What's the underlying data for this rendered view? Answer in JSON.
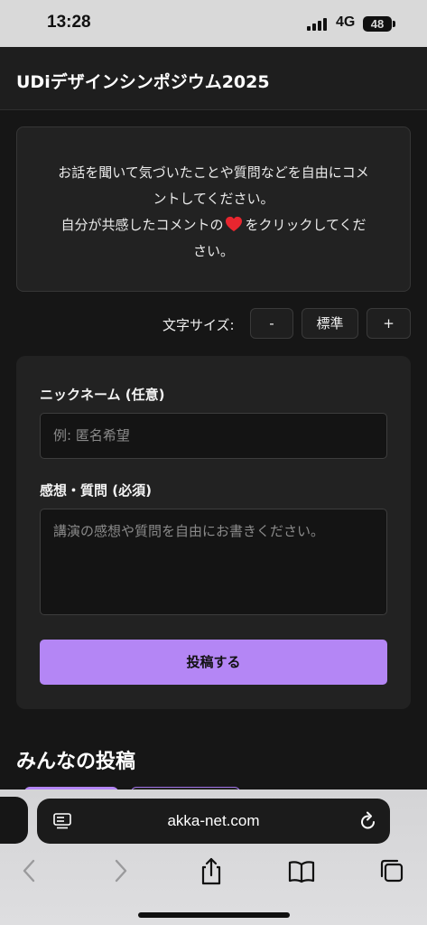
{
  "status_bar": {
    "time": "13:28",
    "network": "4G",
    "battery": "48"
  },
  "header": {
    "title": "UDiデザインシンポジウム2025"
  },
  "intro": {
    "line1": "お話を聞いて気づいたことや質問などを自由にコメ",
    "line2": "ントしてください。",
    "line3_before_icon": "自分が共感したコメントの",
    "line3_after_icon": "をクリックしてくだ",
    "line4": "さい。",
    "icon": "heart-icon",
    "heart_color": "#e8262f"
  },
  "font_size": {
    "label": "文字サイズ:",
    "decrease": "-",
    "standard": "標準",
    "increase": "+"
  },
  "form": {
    "nickname_label": "ニックネーム (任意)",
    "nickname_placeholder": "例: 匿名希望",
    "comment_label": "感想・質問 (必須)",
    "comment_placeholder": "講演の感想や質問を自由にお書きください。",
    "submit_label": "投稿する",
    "accent_color": "#b486f5"
  },
  "posts": {
    "heading": "みんなの投稿"
  },
  "browser": {
    "url": "akka-net.com",
    "icons": [
      "page-menu-icon",
      "reload-icon",
      "back-icon",
      "forward-icon",
      "share-icon",
      "bookmarks-icon",
      "tabs-icon"
    ]
  }
}
